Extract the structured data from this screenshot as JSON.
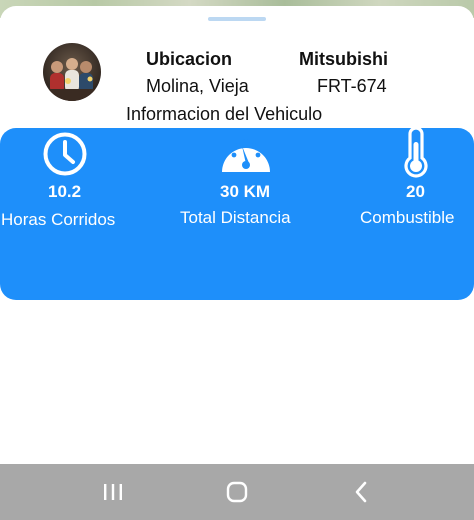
{
  "vehicle": {
    "location_title": "Ubicacion",
    "location_value": "Molina, Vieja",
    "brand": "Mitsubishi",
    "plate": "FRT-674"
  },
  "section_title": "Informacion del Vehiculo",
  "stats": [
    {
      "icon": "clock-icon",
      "value": "10.2",
      "label": "Horas Corridos"
    },
    {
      "icon": "speedometer-icon",
      "value": "30 KM",
      "label": "Total Distancia"
    },
    {
      "icon": "thermometer-icon",
      "value": "20",
      "label": "Combustible"
    }
  ],
  "colors": {
    "card": "#1e8ffa",
    "nav_bar": "#a8a8a8",
    "handle": "#bcd8f2"
  },
  "nav": [
    {
      "icon": "recent-apps-icon"
    },
    {
      "icon": "home-icon"
    },
    {
      "icon": "back-icon"
    }
  ]
}
